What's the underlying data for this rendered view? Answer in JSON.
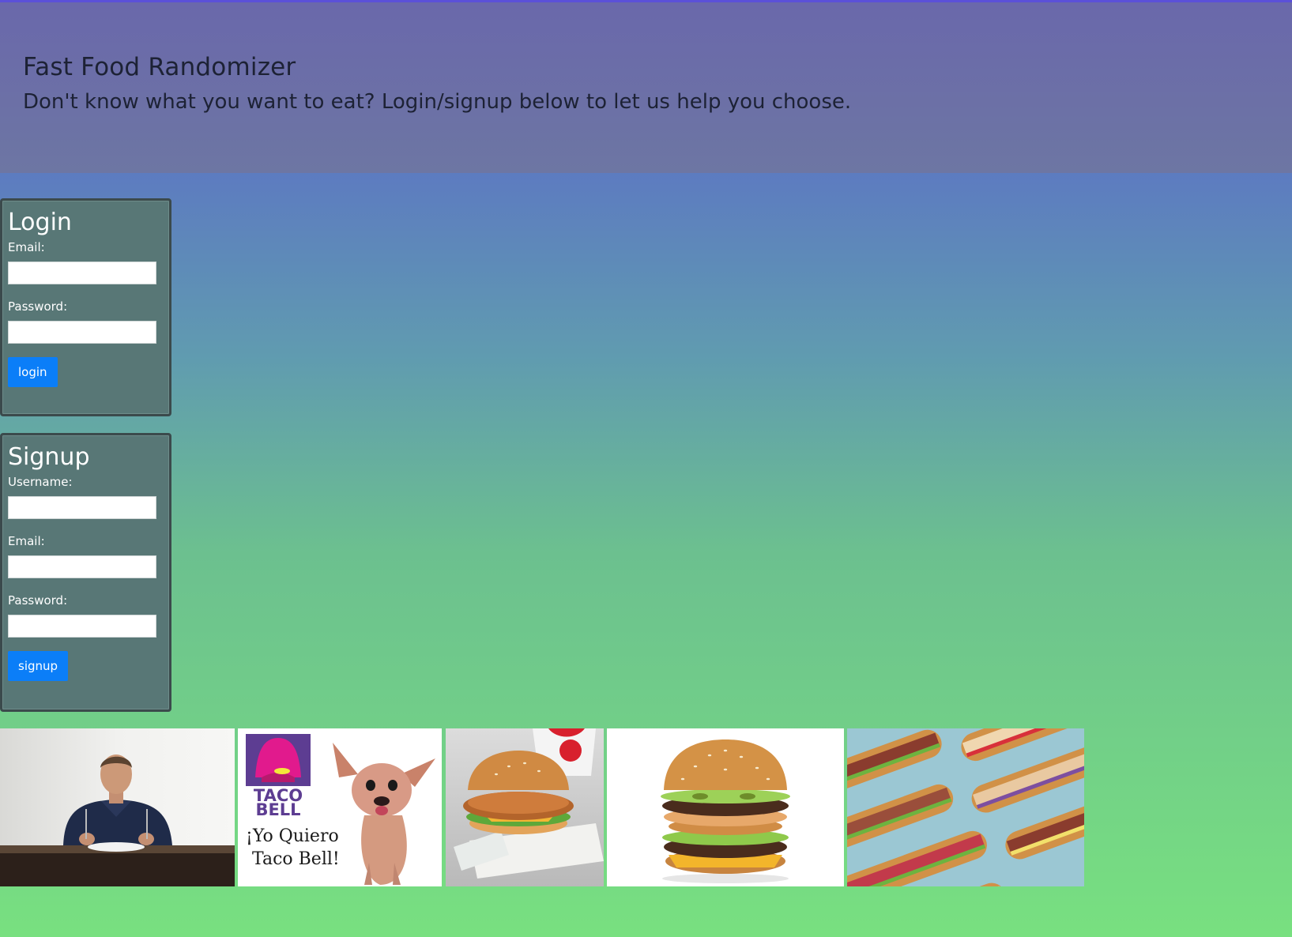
{
  "header": {
    "title": "Fast Food Randomizer",
    "subtitle": "Don't know what you want to eat? Login/signup below to let us help you choose."
  },
  "login": {
    "heading": "Login",
    "email_label": "Email:",
    "email_value": "",
    "password_label": "Password:",
    "password_value": "",
    "button_label": "login"
  },
  "signup": {
    "heading": "Signup",
    "username_label": "Username:",
    "username_value": "",
    "email_label": "Email:",
    "email_value": "",
    "password_label": "Password:",
    "password_value": "",
    "button_label": "signup"
  },
  "gallery": {
    "taco_bell": {
      "logo_line1": "TACO",
      "logo_line2": "BELL",
      "slogan_line1": "¡Yo Quiero",
      "slogan_line2": "Taco Bell!"
    }
  },
  "colors": {
    "button": "#0b7ef8",
    "panel": "#587776",
    "header": "#6a68ab",
    "gradient_top": "#5865c9",
    "gradient_bottom": "#78e080"
  }
}
